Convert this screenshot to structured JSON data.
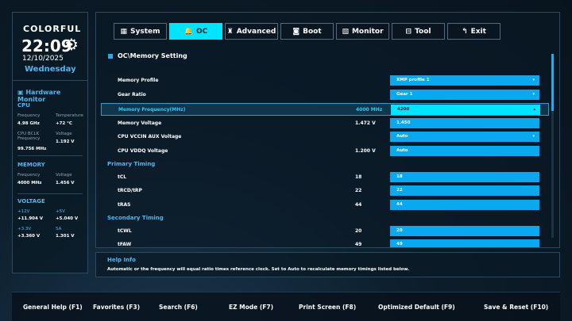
{
  "sidebar": {
    "brand": "COLORFUL",
    "time": "22:09",
    "date": "12/10/2025",
    "day": "Wednesday",
    "title": "Hardware Monitor",
    "cpu": {
      "label": "CPU",
      "freq_k": "Frequency",
      "freq_v": "4.98 GHz",
      "temp_k": "Temperature",
      "temp_v": "+72 °C",
      "bclk_k": "CPU BCLK Frequency",
      "bclk_v": "99.756 MHz",
      "volt_k": "Voltage",
      "volt_v": "1.192 V"
    },
    "memory": {
      "label": "MEMORY",
      "freq_k": "Frequency",
      "freq_v": "4000 MHz",
      "volt_k": "Voltage",
      "volt_v": "1.456 V"
    },
    "voltage": {
      "label": "VOLTAGE",
      "v12_k": "+12V",
      "v12_v": "+11.904 V",
      "v5_k": "+5V",
      "v5_v": "+5.040 V",
      "v33_k": "+3.3V",
      "v33_v": "+3.360 V",
      "sa_k": "SA",
      "sa_v": "1.301 V"
    }
  },
  "tabs": [
    {
      "label": "System",
      "icon": "▦"
    },
    {
      "label": "OC",
      "icon": "🔔"
    },
    {
      "label": "Advanced",
      "icon": "♜"
    },
    {
      "label": "Boot",
      "icon": "◙"
    },
    {
      "label": "Monitor",
      "icon": "▧"
    },
    {
      "label": "Tool",
      "icon": "⊟"
    },
    {
      "label": "Exit",
      "icon": "↰"
    }
  ],
  "breadcrumb": "OC\\Memory Setting",
  "rows": [
    {
      "label": "Memory Profile",
      "current": "",
      "value": "XMP profile 1",
      "arrow": "▾"
    },
    {
      "label": "Gear Ratio",
      "current": "",
      "value": "Gear 1",
      "arrow": "▾"
    },
    {
      "label": "Memory Frequency(MHz)",
      "current": "4000 MHz",
      "value": "4200",
      "arrow": "▴"
    },
    {
      "label": "Memory Voltage",
      "current": "1.472 V",
      "value": "1.450",
      "arrow": ""
    },
    {
      "label": "CPU VCCIN AUX Voltage",
      "current": "",
      "value": "Auto",
      "arrow": "▾"
    },
    {
      "label": "CPU VDDQ Voltage",
      "current": "1.200 V",
      "value": "Auto",
      "arrow": ""
    },
    {
      "label": "tCL",
      "current": "18",
      "value": "18",
      "arrow": ""
    },
    {
      "label": "tRCD/tRP",
      "current": "22",
      "value": "22",
      "arrow": ""
    },
    {
      "label": "tRAS",
      "current": "44",
      "value": "44",
      "arrow": ""
    },
    {
      "label": "tCWL",
      "current": "20",
      "value": "20",
      "arrow": ""
    },
    {
      "label": "tFAW",
      "current": "49",
      "value": "49",
      "arrow": ""
    }
  ],
  "groups": {
    "primary": "Primary Timing",
    "secondary": "Secondary Timing"
  },
  "help": {
    "title": "Help Info",
    "text": "Automatic or the frequency will equal ratio times reference clock. Set to Auto to recalculate memory timings listed below."
  },
  "footer": [
    "General Help (F1)",
    "Favorites (F3)",
    "Search (F6)",
    "EZ Mode (F7)",
    "Print Screen (F8)",
    "Optimized Default (F9)",
    "Save & Reset (F10)"
  ]
}
